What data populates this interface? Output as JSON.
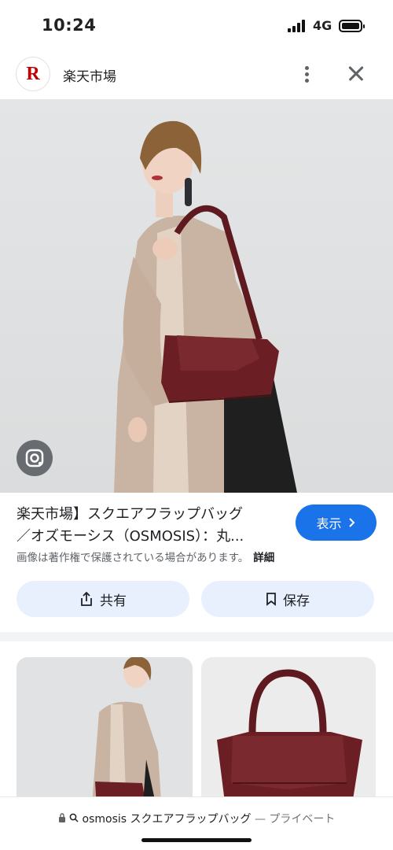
{
  "status_bar": {
    "time": "10:24",
    "network": "4G"
  },
  "header": {
    "site_name": "楽天市場",
    "logo_letter": "R",
    "logo_color": "#bf0000"
  },
  "result": {
    "title_line1": "楽天市場】スクエアフラップバッグ",
    "title_line2": "／オズモーシス（OSMOSIS）：丸...",
    "visit_label": "表示",
    "visit_color": "#1a73e8",
    "copyright_notice": "画像は著作権で保護されている場合があります。",
    "detail_label": "詳細"
  },
  "actions": {
    "share_label": "共有",
    "save_label": "保存"
  },
  "address_bar": {
    "query": "osmosis スクエアフラップバッグ",
    "mode": "— プライベート"
  },
  "icons": [
    "lens-icon",
    "more-vert-icon",
    "close-icon",
    "share-icon",
    "bookmark-icon",
    "lock-icon",
    "search-icon",
    "chevron-right-icon"
  ]
}
